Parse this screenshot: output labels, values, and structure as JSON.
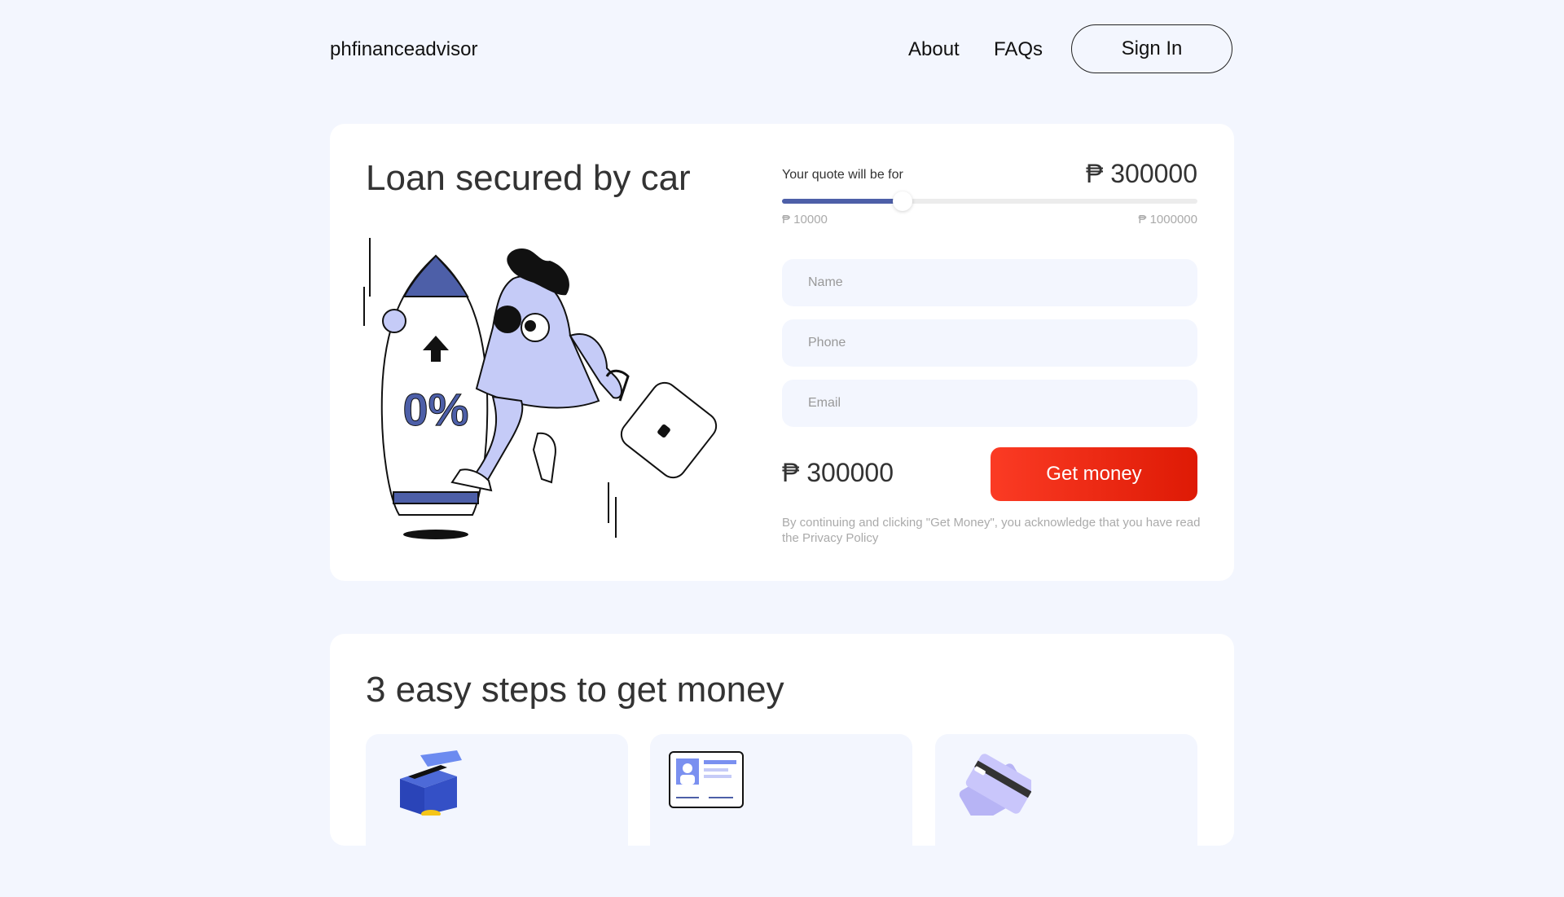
{
  "header": {
    "logo": "phfinanceadvisor",
    "nav": {
      "about": "About",
      "faqs": "FAQs"
    },
    "signin": "Sign In"
  },
  "hero": {
    "title": "Loan secured by car",
    "illustration_text": "0%",
    "quote": {
      "label": "Your quote will be for",
      "value": "₱ 300000",
      "min_label": "₱ 10000",
      "max_label": "₱ 1000000",
      "slider_fraction": 0.29
    },
    "form": {
      "name_placeholder": "Name",
      "phone_placeholder": "Phone",
      "email_placeholder": "Email"
    },
    "amount": "₱ 300000",
    "cta": "Get money",
    "disclaimer": "By continuing and clicking \"Get Money\", you acknowledge that you have read the Privacy Policy"
  },
  "steps": {
    "title": "3 easy steps to get money",
    "cards": [
      {
        "icon": "box-icon"
      },
      {
        "icon": "id-card-icon"
      },
      {
        "icon": "credit-card-icon"
      }
    ]
  },
  "colors": {
    "page_bg": "#f3f6fe",
    "accent_blue": "#4d5fa8",
    "illustration_blue": "#c5cbf7",
    "cta_red": "#ef2c16"
  }
}
